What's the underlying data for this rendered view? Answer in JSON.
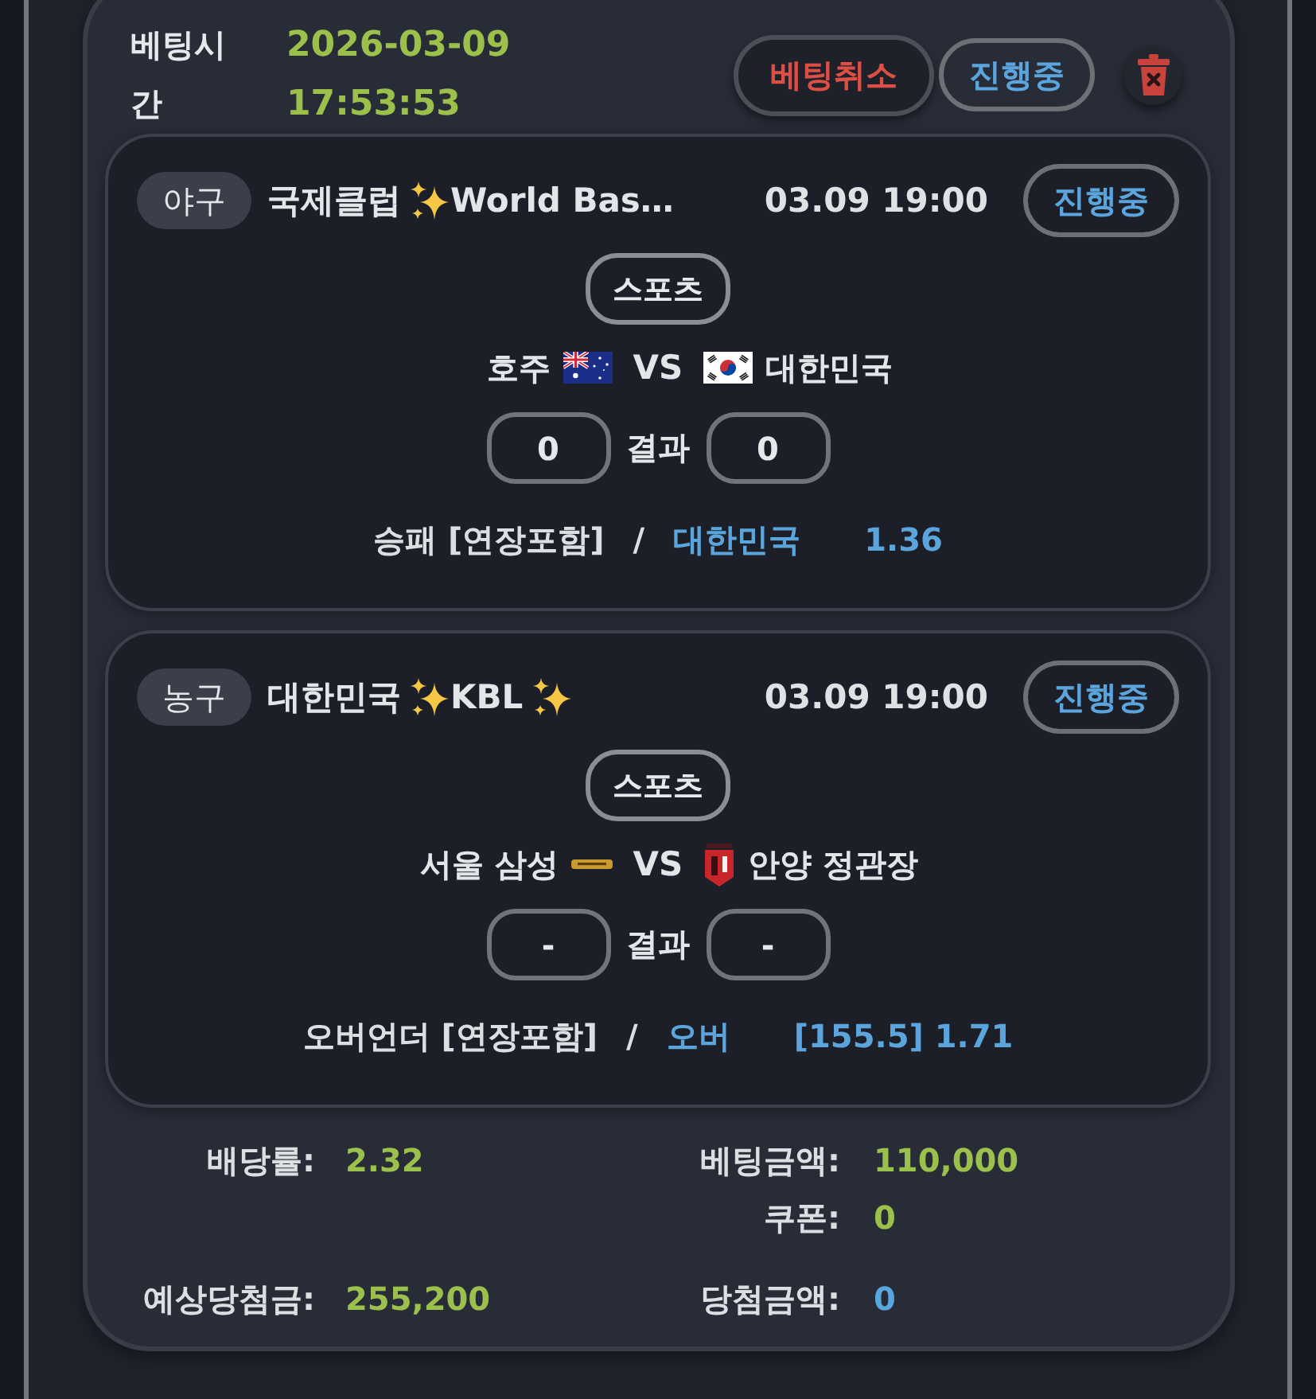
{
  "bet_time": {
    "label": "베팅시간",
    "date": "2026-03-09",
    "time": "17:53:53"
  },
  "actions": [
    {
      "kind": "cancel",
      "label": "베팅취소"
    },
    {
      "kind": "status",
      "label": "진행중"
    },
    {
      "kind": "delete"
    }
  ],
  "matches": [
    {
      "sport": "야구",
      "league": [
        {
          "kind": "text",
          "text": "국제클럽"
        },
        {
          "kind": "sparkle"
        },
        {
          "kind": "text",
          "text": "World Bas…"
        }
      ],
      "start": "03.09 19:00",
      "status": "진행중",
      "category": "스포츠",
      "teams": [
        {
          "name": "호주",
          "kind": "flag_au"
        },
        {
          "name": "대한민국",
          "kind": "flag_kr"
        }
      ],
      "versus": "VS",
      "scores": [
        "0",
        "0"
      ],
      "result_label": "결과",
      "market": "승패 [연장포함]",
      "separator": "/",
      "pick": "대한민국",
      "odds": "1.36"
    },
    {
      "sport": "농구",
      "league": [
        {
          "kind": "text",
          "text": "대한민국"
        },
        {
          "kind": "sparkle"
        },
        {
          "kind": "text",
          "text": "KBL"
        },
        {
          "kind": "sparkle"
        }
      ],
      "start": "03.09 19:00",
      "status": "진행중",
      "category": "스포츠",
      "teams": [
        {
          "name": "서울 삼성",
          "kind": "logo_gold"
        },
        {
          "name": "안양 정관장",
          "kind": "logo_red"
        }
      ],
      "versus": "VS",
      "scores": [
        "-",
        "-"
      ],
      "result_label": "결과",
      "market": "오버언더 [연장포함]",
      "separator": "/",
      "pick": "오버",
      "odds": "[155.5] 1.71"
    }
  ],
  "summary": [
    {
      "left": {
        "label": "배당률:",
        "value": "2.32",
        "color": "#9cc04c"
      },
      "right": {
        "label": "베팅금액:",
        "value": "110,000",
        "color": "#9cc04c"
      }
    },
    {
      "right": {
        "label": "쿠폰:",
        "value": "0",
        "color": "#9cc04c"
      }
    },
    {
      "left": {
        "label": "예상당첨금:",
        "value": "255,200",
        "color": "#9cc04c"
      },
      "right": {
        "label": "당첨금액:",
        "value": "0",
        "color": "#58a6dc"
      }
    }
  ]
}
